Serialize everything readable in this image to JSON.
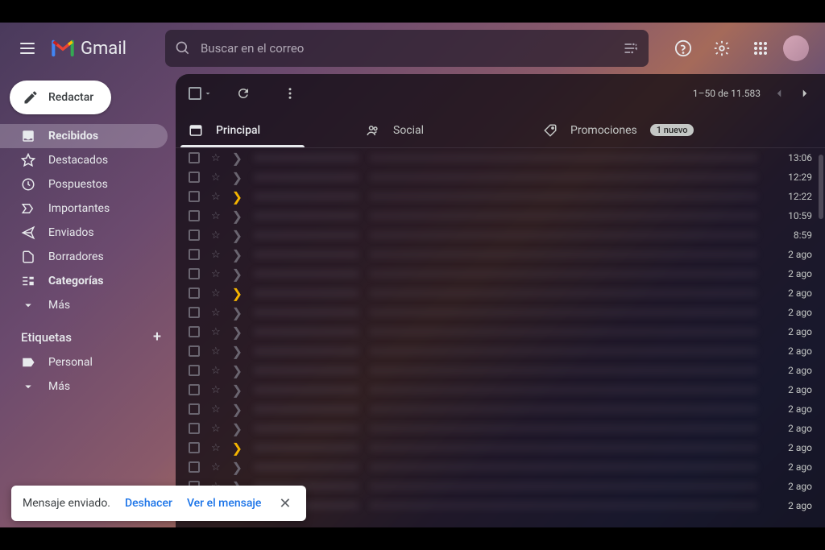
{
  "header": {
    "product": "Gmail",
    "search_placeholder": "Buscar en el correo"
  },
  "compose_label": "Redactar",
  "nav": [
    {
      "icon": "inbox",
      "label": "Recibidos",
      "active": true,
      "bold": true
    },
    {
      "icon": "star",
      "label": "Destacados"
    },
    {
      "icon": "clock",
      "label": "Pospuestos"
    },
    {
      "icon": "important",
      "label": "Importantes"
    },
    {
      "icon": "send",
      "label": "Enviados"
    },
    {
      "icon": "draft",
      "label": "Borradores"
    },
    {
      "icon": "categories",
      "label": "Categorías",
      "bold": true
    },
    {
      "icon": "more",
      "label": "Más"
    }
  ],
  "labels_header": "Etiquetas",
  "labels": [
    {
      "icon": "label",
      "label": "Personal"
    },
    {
      "icon": "more",
      "label": "Más"
    }
  ],
  "pagination": "1–50 de 11.583",
  "tabs": [
    {
      "icon": "inbox-tab",
      "label": "Principal",
      "active": true
    },
    {
      "icon": "social",
      "label": "Social"
    },
    {
      "icon": "tag",
      "label": "Promociones",
      "badge": "1 nuevo"
    }
  ],
  "emails": [
    {
      "important": false,
      "star": false,
      "time": "13:06"
    },
    {
      "important": false,
      "star": false,
      "time": "12:29"
    },
    {
      "important": true,
      "star": false,
      "time": "12:22"
    },
    {
      "important": false,
      "star": false,
      "time": "10:59"
    },
    {
      "important": false,
      "star": false,
      "time": "8:59"
    },
    {
      "important": false,
      "star": false,
      "time": "2 ago"
    },
    {
      "important": false,
      "star": false,
      "time": "2 ago"
    },
    {
      "important": true,
      "star": false,
      "time": "2 ago"
    },
    {
      "important": false,
      "star": false,
      "time": "2 ago"
    },
    {
      "important": false,
      "star": false,
      "time": "2 ago"
    },
    {
      "important": false,
      "star": false,
      "time": "2 ago"
    },
    {
      "important": false,
      "star": false,
      "time": "2 ago"
    },
    {
      "important": false,
      "star": false,
      "time": "2 ago"
    },
    {
      "important": false,
      "star": false,
      "time": "2 ago"
    },
    {
      "important": false,
      "star": false,
      "time": "2 ago"
    },
    {
      "important": true,
      "star": false,
      "time": "2 ago"
    },
    {
      "important": false,
      "star": false,
      "time": "2 ago"
    },
    {
      "important": false,
      "star": false,
      "time": "2 ago"
    },
    {
      "important": false,
      "star": false,
      "time": "2 ago"
    }
  ],
  "toast": {
    "message": "Mensaje enviado.",
    "undo": "Deshacer",
    "view": "Ver el mensaje"
  }
}
